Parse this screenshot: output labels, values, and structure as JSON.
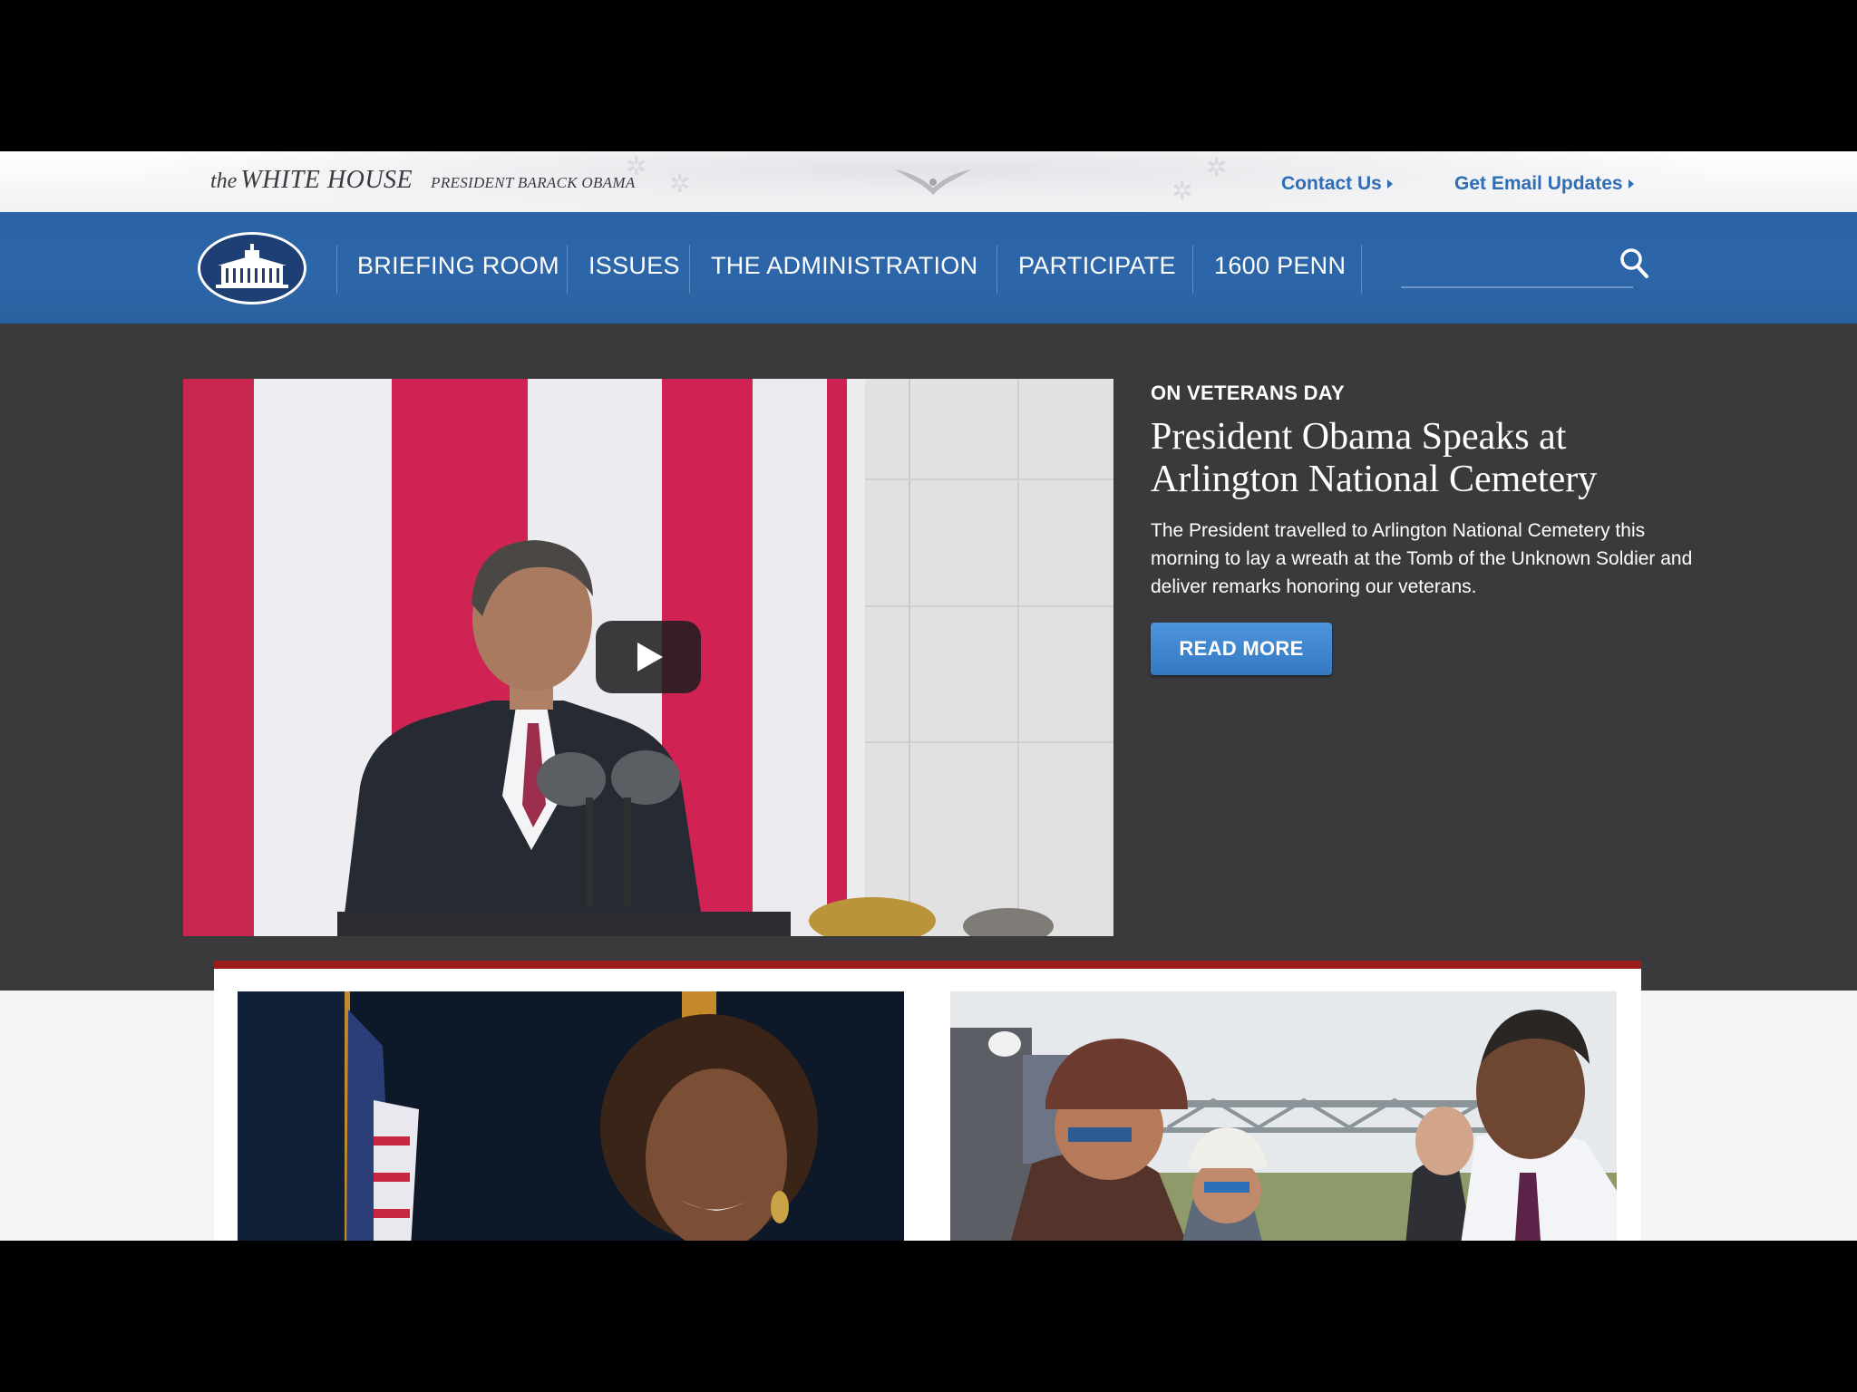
{
  "header": {
    "wordmark_the": "the",
    "wordmark_name": "WHITE HOUSE",
    "wordmark_president": "PRESIDENT BARACK OBAMA",
    "contact_label": "Contact Us",
    "email_label": "Get Email Updates"
  },
  "nav": {
    "items": [
      {
        "label": "BRIEFING ROOM"
      },
      {
        "label": "ISSUES"
      },
      {
        "label": "THE ADMINISTRATION"
      },
      {
        "label": "PARTICIPATE"
      },
      {
        "label": "1600 PENN"
      }
    ],
    "search_placeholder": ""
  },
  "hero": {
    "eyebrow": "ON VETERANS DAY",
    "headline": "President Obama Speaks at Arlington National Cemetery",
    "summary": "The President travelled to Arlington National Cemetery this morning to lay a wreath at the Tomb of the Unknown Soldier and deliver remarks honoring our veterans.",
    "button_label": "READ MORE"
  },
  "colors": {
    "nav_blue": "#2d66a8",
    "link_blue": "#2f6eb5",
    "hero_bg": "#3a3a3d",
    "panel_accent": "#9b1c1c",
    "button_blue": "#3d86d0"
  },
  "icons": {
    "search": "search-icon",
    "play": "play-icon",
    "logo": "white-house-logo",
    "caret": "caret-right-icon"
  }
}
